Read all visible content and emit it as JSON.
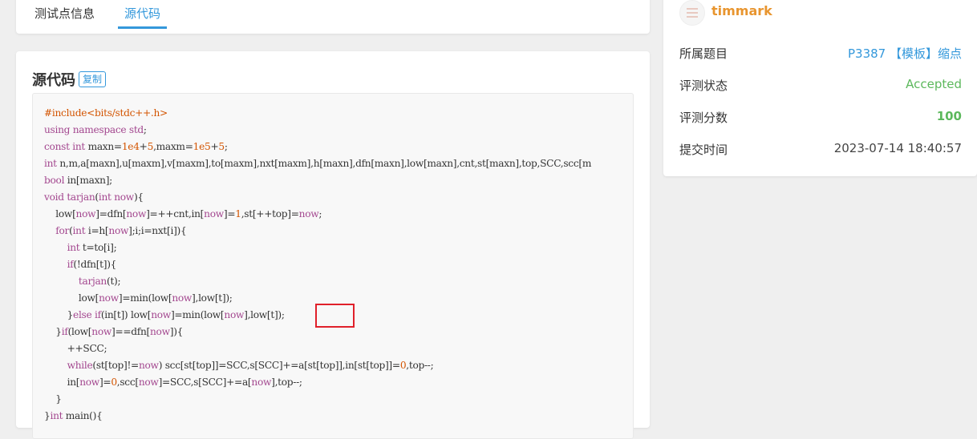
{
  "tabs": {
    "test_info": "测试点信息",
    "source": "源代码"
  },
  "code_section": {
    "title": "源代码",
    "copy_label": "复制",
    "lines": [
      "#include<bits/stdc++.h>",
      "using namespace std;",
      "const int maxn=1e4+5,maxm=1e5+5;",
      "int n,m,a[maxn],u[maxm],v[maxm],to[maxm],nxt[maxm],h[maxn],dfn[maxn],low[maxn],cnt,st[maxn],top,SCC,scc[m",
      "bool in[maxn];",
      "void tarjan(int now){",
      "    low[now]=dfn[now]=++cnt,in[now]=1,st[++top]=now;",
      "    for(int i=h[now];i;i=nxt[i]){",
      "        int t=to[i];",
      "        if(!dfn[t]){",
      "            tarjan(t);",
      "            low[now]=min(low[now],low[t]);",
      "        }else if(in[t]) low[now]=min(low[now],low[t]);",
      "    }if(low[now]==dfn[now]){",
      "        ++SCC;",
      "        while(st[top]!=now) scc[st[top]]=SCC,s[SCC]+=a[st[top]],in[st[top]]=0,top--;",
      "        in[now]=0,scc[now]=SCC,s[SCC]+=a[now],top--;",
      "    }",
      "}int main(){"
    ]
  },
  "user": {
    "name": "timmark"
  },
  "info": {
    "problem_label": "所属题目",
    "problem_value": "P3387 【模板】缩点",
    "status_label": "评测状态",
    "status_value": "Accepted",
    "score_label": "评测分数",
    "score_value": "100",
    "time_label": "提交时间",
    "time_value": "2023-07-14 18:40:57"
  },
  "colors": {
    "accent": "#3498db",
    "accepted": "#5cb85c",
    "username": "#e8952f",
    "highlight": "#e0202a"
  }
}
